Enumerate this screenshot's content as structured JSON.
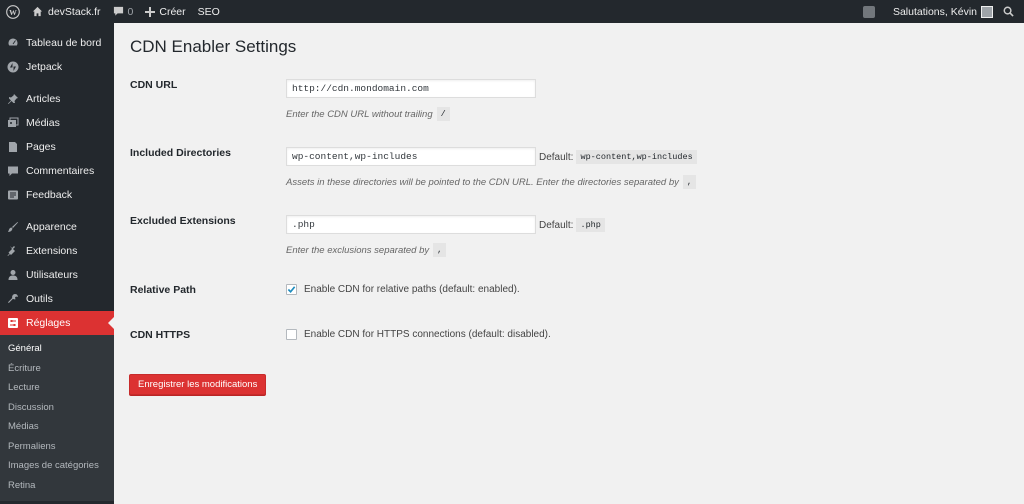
{
  "adminbar": {
    "site_name": "devStack.fr",
    "comments_count": "0",
    "new_label": "Créer",
    "seo_label": "SEO",
    "greeting": "Salutations, Kévin"
  },
  "sidebar": {
    "items": [
      {
        "label": "Tableau de bord",
        "icon": "dashboard-icon"
      },
      {
        "label": "Jetpack",
        "icon": "jetpack-icon"
      },
      {
        "label": "Articles",
        "icon": "pin-icon"
      },
      {
        "label": "Médias",
        "icon": "media-icon"
      },
      {
        "label": "Pages",
        "icon": "page-icon"
      },
      {
        "label": "Commentaires",
        "icon": "comment-icon"
      },
      {
        "label": "Feedback",
        "icon": "feedback-icon"
      },
      {
        "label": "Apparence",
        "icon": "brush-icon"
      },
      {
        "label": "Extensions",
        "icon": "plugin-icon"
      },
      {
        "label": "Utilisateurs",
        "icon": "user-icon"
      },
      {
        "label": "Outils",
        "icon": "wrench-icon"
      },
      {
        "label": "Réglages",
        "icon": "settings-icon"
      }
    ],
    "submenu": [
      "Général",
      "Écriture",
      "Lecture",
      "Discussion",
      "Médias",
      "Permaliens",
      "Images de catégories",
      "Retina"
    ]
  },
  "page": {
    "title": "CDN Enabler Settings",
    "cdn_url": {
      "label": "CDN URL",
      "value": "http://cdn.mondomain.com",
      "desc": "Enter the CDN URL without trailing",
      "desc_code": "/"
    },
    "included": {
      "label": "Included Directories",
      "value": "wp-content,wp-includes",
      "default_label": "Default:",
      "default_code": "wp-content,wp-includes",
      "desc": "Assets in these directories will be pointed to the CDN URL. Enter the directories separated by",
      "desc_code": ","
    },
    "excluded": {
      "label": "Excluded Extensions",
      "value": ".php",
      "default_label": "Default:",
      "default_code": ".php",
      "desc": "Enter the exclusions separated by",
      "desc_code": ","
    },
    "relative": {
      "label": "Relative Path",
      "checkbox_label": "Enable CDN for relative paths (default: enabled).",
      "checked": true
    },
    "https": {
      "label": "CDN HTTPS",
      "checkbox_label": "Enable CDN for HTTPS connections (default: disabled).",
      "checked": false
    },
    "save_label": "Enregistrer les modifications"
  },
  "colors": {
    "adminbar_bg": "#23282d",
    "accent": "#dc3232",
    "checkbox_check": "#1e8cbe"
  }
}
